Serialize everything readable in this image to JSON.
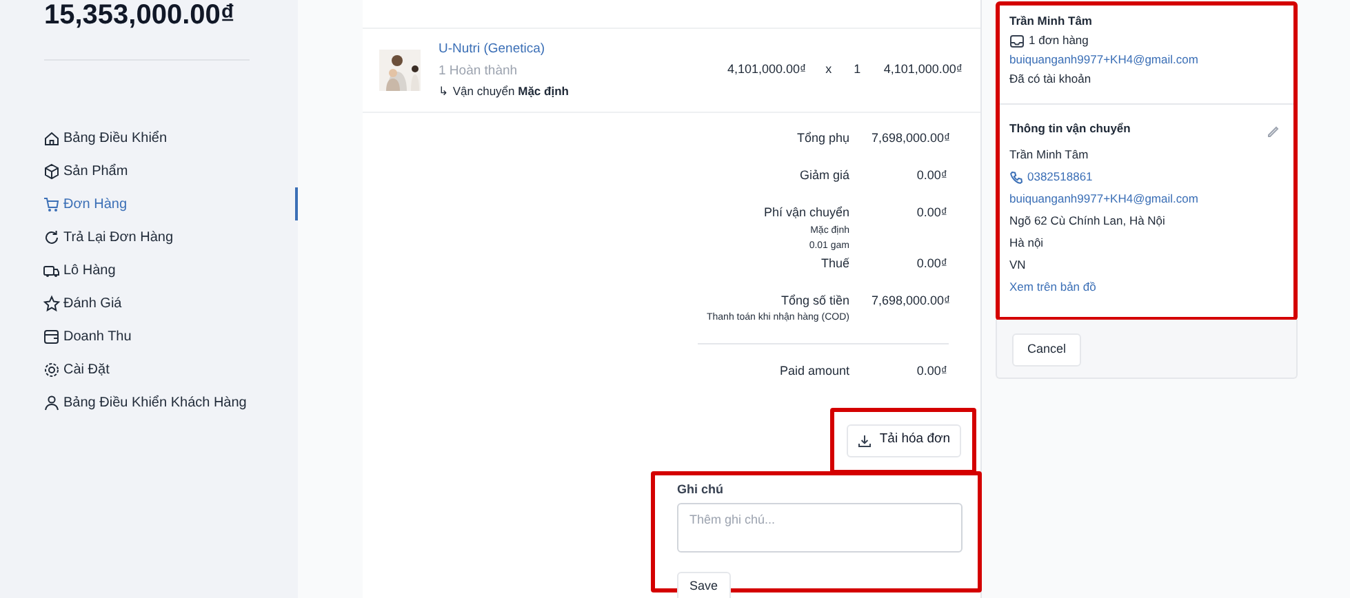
{
  "sidebar": {
    "total": "15,353,000.00₫",
    "items": [
      {
        "label": "Bảng Điều Khiển",
        "selected": false
      },
      {
        "label": "Sản Phẩm",
        "selected": false
      },
      {
        "label": "Đơn Hàng",
        "selected": true
      },
      {
        "label": "Trả Lại Đơn Hàng",
        "selected": false
      },
      {
        "label": "Lô Hàng",
        "selected": false
      },
      {
        "label": "Đánh Giá",
        "selected": false
      },
      {
        "label": "Doanh Thu",
        "selected": false
      },
      {
        "label": "Cài Đặt",
        "selected": false
      },
      {
        "label": "Bảng Điều Khiển Khách Hàng",
        "selected": false
      }
    ]
  },
  "order": {
    "items": [
      {
        "name": "U-Nutri (Genetica)",
        "status": "1 Hoàn thành",
        "shipping": "↳ Vận chuyển **Mặc định**",
        "price": "4,101,000.00₫",
        "times": "x",
        "quantity": "1",
        "total": "4,101,000.00₫"
      }
    ],
    "summary": [
      {
        "label": "Tổng phụ",
        "value": "7,698,000.00₫"
      },
      {
        "label": "Giảm giá",
        "value": "0.00₫"
      },
      {
        "label": "Phí vận chuyển",
        "notes": [
          "Mặc định",
          "0.01 gam"
        ],
        "value": "0.00₫"
      },
      {
        "label": "Thuế",
        "value": "0.00₫"
      },
      {
        "label": "Tổng số tiền",
        "notes": [
          "Thanh toán khi nhận hàng (COD)"
        ],
        "value": "7,698,000.00₫"
      },
      {
        "kind": "divider"
      },
      {
        "label": "Paid amount",
        "value": "0.00₫"
      }
    ],
    "download_button": "Tải hóa đơn",
    "note": {
      "label": "Ghi chú",
      "placeholder": "Thêm ghi chú...",
      "save_button": "Save"
    }
  },
  "customer": {
    "name": "Trần Minh Tâm",
    "orders": "1 đơn hàng",
    "email": "buiquanganh9977+KH4@gmail.com",
    "account": "Đã có tài khoản"
  },
  "shipping": {
    "title": "Thông tin vận chuyển",
    "name": "Trần Minh Tâm",
    "phone": "0382518861",
    "email": "buiquanganh9977+KH4@gmail.com",
    "address": "Ngõ 62 Cù Chính Lan, Hà Nội",
    "city": "Hà nội",
    "country": "VN",
    "map_link": "Xem trên bản đồ"
  },
  "cancel_button": "Cancel"
}
